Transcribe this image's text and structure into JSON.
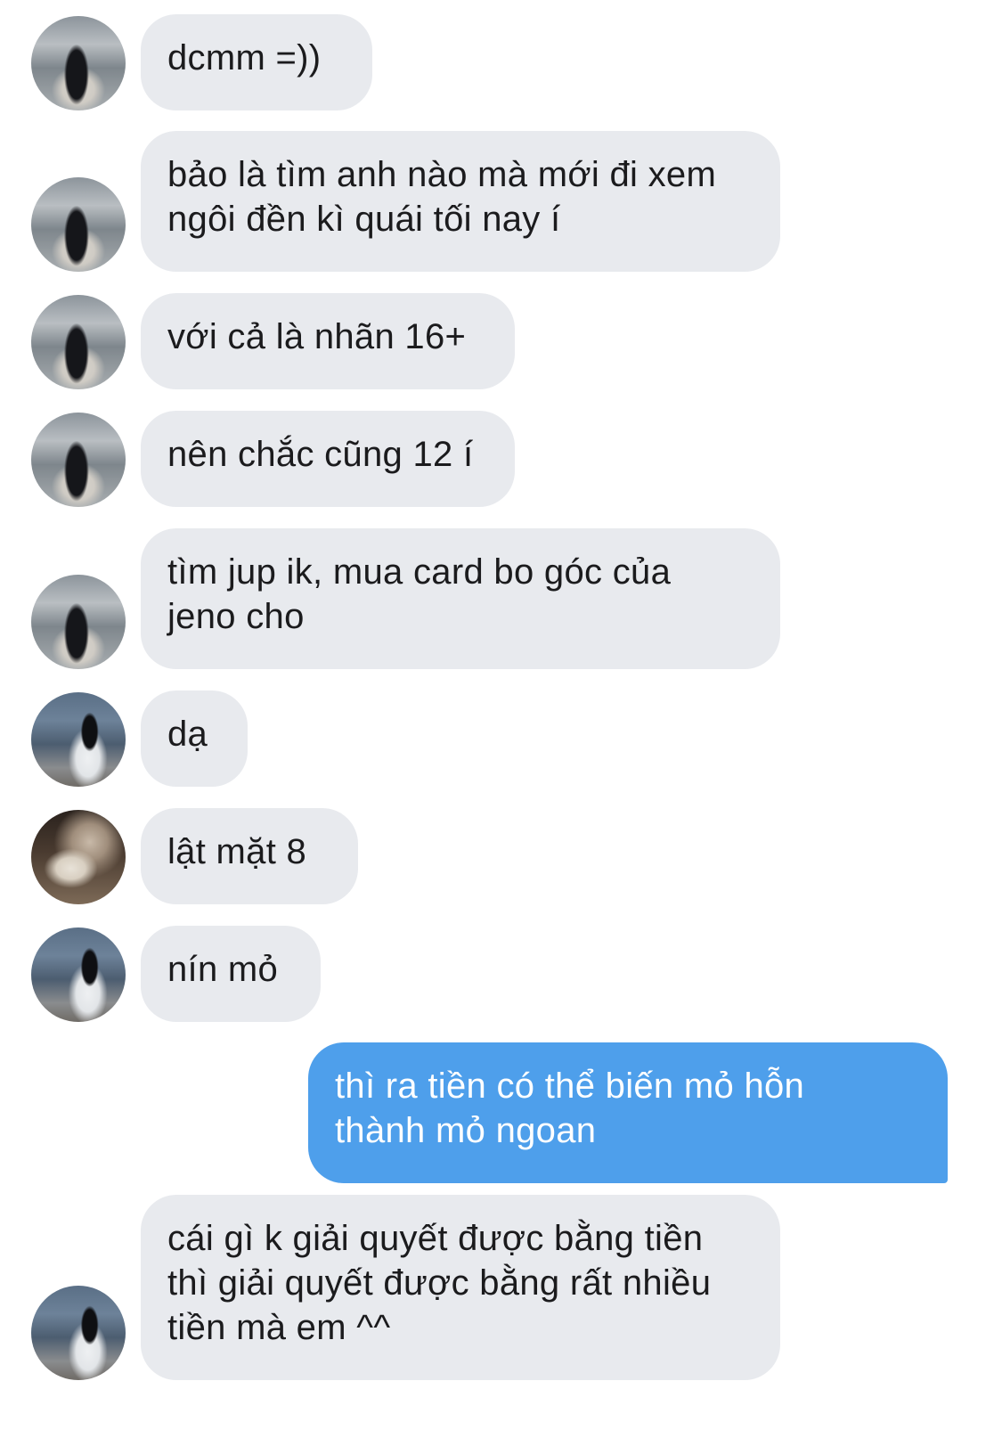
{
  "conversation": {
    "messages": [
      {
        "direction": "incoming",
        "avatar": "avatar-sea-girl-1",
        "text": "dcmm =))"
      },
      {
        "direction": "incoming",
        "avatar": "avatar-sea-girl-1",
        "text": "bảo là tìm anh nào mà mới đi xem\nngôi đền kì quái tối nay í"
      },
      {
        "direction": "incoming",
        "avatar": "avatar-sea-girl-1",
        "text": "với cả là nhãn 16+"
      },
      {
        "direction": "incoming",
        "avatar": "avatar-sea-girl-1",
        "text": "nên chắc cũng 12 í"
      },
      {
        "direction": "incoming",
        "avatar": "avatar-sea-girl-1",
        "text": "tìm jup ik, mua card bo góc của\njeno cho"
      },
      {
        "direction": "incoming",
        "avatar": "avatar-beach-girl-2",
        "text": "dạ"
      },
      {
        "direction": "incoming",
        "avatar": "avatar-girl-with-cat",
        "text": "lật mặt 8"
      },
      {
        "direction": "incoming",
        "avatar": "avatar-beach-girl-2",
        "text": "nín mỏ"
      },
      {
        "direction": "outgoing",
        "avatar": "",
        "text": "thì ra tiền có thể biến mỏ hỗn\nthành mỏ ngoan"
      },
      {
        "direction": "incoming",
        "avatar": "avatar-beach-girl-2",
        "text": "cái gì k giải quyết được bằng tiền\nthì giải quyết được bằng rất nhiều\ntiền mà em ^^"
      }
    ]
  },
  "colors": {
    "incoming_bubble": "#e8eaee",
    "outgoing_bubble": "#4e9feb",
    "background": "#ffffff"
  }
}
